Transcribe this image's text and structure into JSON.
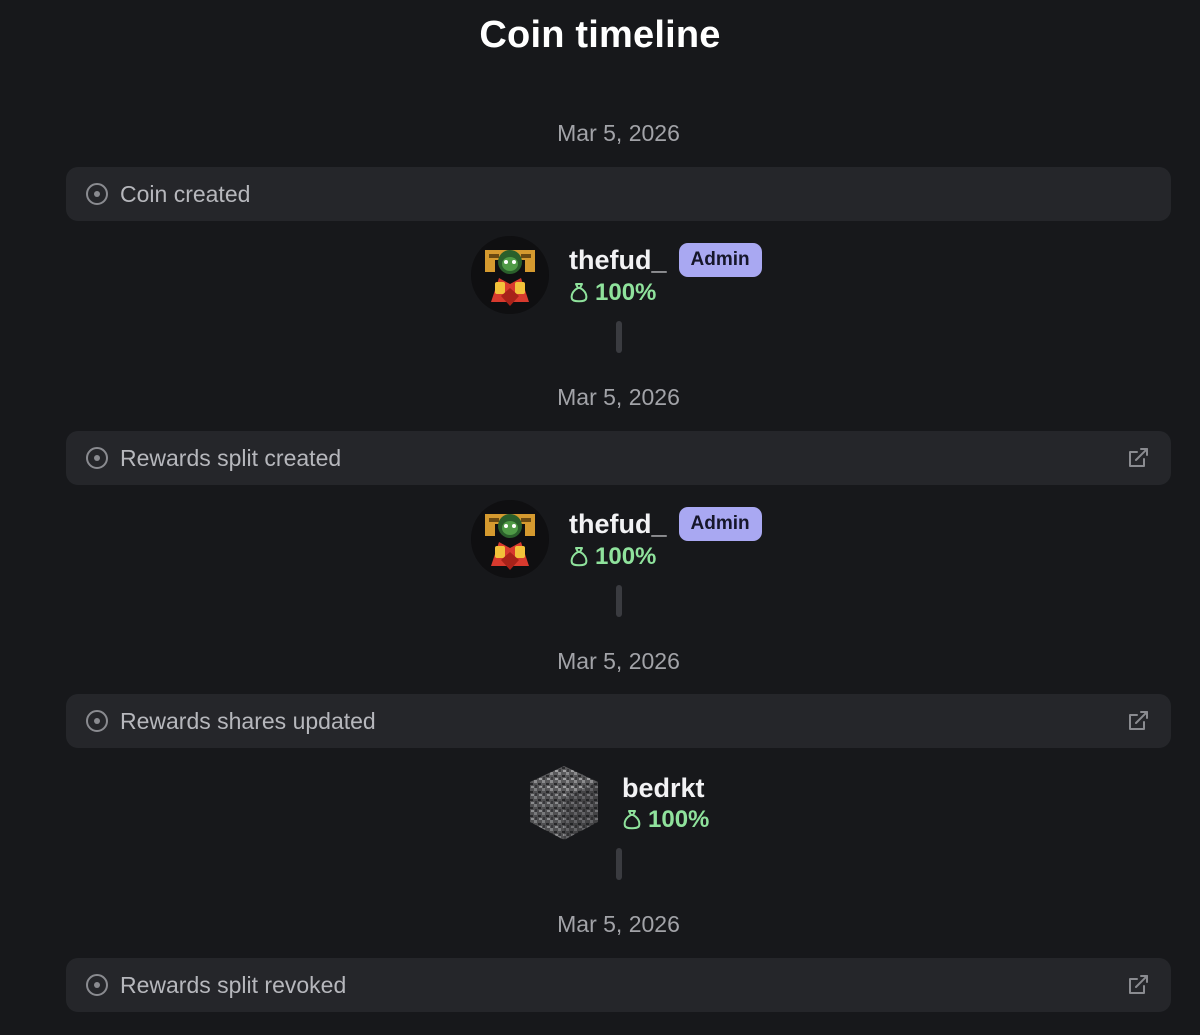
{
  "page": {
    "title": "Coin timeline"
  },
  "timeline": [
    {
      "date": "Mar 5, 2026",
      "event": "Coin created",
      "has_link": false,
      "holder": {
        "username": "thefud_",
        "badge": "Admin",
        "share": "100%",
        "avatar": "pepe-avatar"
      }
    },
    {
      "date": "Mar 5, 2026",
      "event": "Rewards split created",
      "has_link": true,
      "holder": {
        "username": "thefud_",
        "badge": "Admin",
        "share": "100%",
        "avatar": "pepe-avatar"
      }
    },
    {
      "date": "Mar 5, 2026",
      "event": "Rewards shares updated",
      "has_link": true,
      "holder": {
        "username": "bedrkt",
        "badge": "",
        "share": "100%",
        "avatar": "bedrock-cube-avatar"
      }
    },
    {
      "date": "Mar 5, 2026",
      "event": "Rewards split revoked",
      "has_link": true
    }
  ],
  "colors": {
    "background": "#17181b",
    "card": "#25262a",
    "badge": "#a9a8f2",
    "share": "#8fe29c"
  },
  "icons": {
    "event": "circle-dot-icon",
    "link": "external-link-icon",
    "share": "money-bag-icon"
  }
}
